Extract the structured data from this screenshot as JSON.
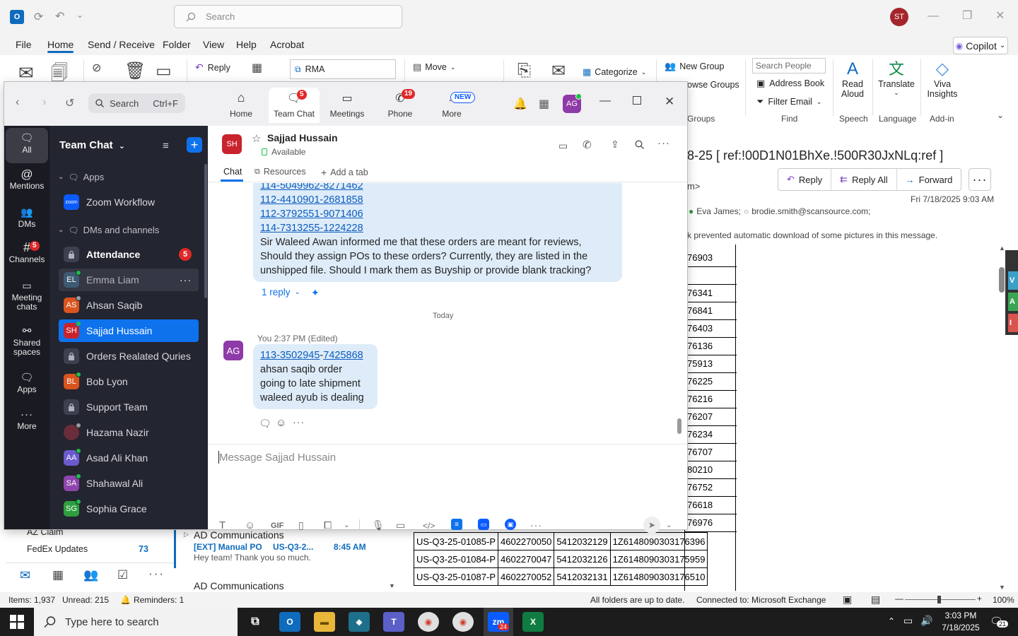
{
  "outlook": {
    "search_placeholder": "Search",
    "avatar": "ST",
    "menu": [
      "File",
      "Home",
      "Send / Receive",
      "Folder",
      "View",
      "Help",
      "Acrobat"
    ],
    "copilot": "Copilot",
    "ribbon": {
      "reply": "Reply",
      "quick_step": "RMA",
      "move": "Move",
      "categorize": "Categorize",
      "new_group": "New Group",
      "browse_groups": "owse Groups",
      "groups_label": "Groups",
      "search_people_placeholder": "Search People",
      "address_book": "Address Book",
      "filter_email": "Filter Email",
      "find_label": "Find",
      "read_aloud_1": "Read",
      "read_aloud_2": "Aloud",
      "speech_label": "Speech",
      "translate": "Translate",
      "language_label": "Language",
      "viva_1": "Viva",
      "viva_2": "Insights",
      "addin_label": "Add-in"
    },
    "email": {
      "subject": "8-25    [ ref:!00D1N01BhXe.!500R30JxNLq:ref ]",
      "reply": "Reply",
      "reply_all": "Reply All",
      "forward": "Forward",
      "from_tail": "m>",
      "date": "Fri 7/18/2025 9:03 AM",
      "recipient1": "Eva James;",
      "recipient2": "brodie.smith@scansource.com;",
      "notice": "k prevented automatic download of some pictures in this message.",
      "tracking_tails": [
        "76903",
        "",
        "76341",
        "76841",
        "76403",
        "76136",
        "75913",
        "76225",
        "76216",
        "76207",
        "76234",
        "76707",
        "80210",
        "76752",
        "76618",
        "76976"
      ],
      "rows": [
        [
          "US-Q3-25-01085-P",
          "4602270050",
          "5412032129",
          "1Z6148090303176396"
        ],
        [
          "US-Q3-25-01084-P",
          "4602270047",
          "5412032126",
          "1Z6148090303175959"
        ],
        [
          "US-Q3-25-01087-P",
          "4602270052",
          "5412032131",
          "1Z6148090303176510"
        ]
      ]
    },
    "folders": [
      {
        "name": "AZ Claim",
        "count": ""
      },
      {
        "name": "FedEx Updates",
        "count": "73"
      }
    ],
    "maillist": {
      "group1": "AD Communications",
      "sender": "[EXT] Manual PO",
      "subject": "US-Q3-2...",
      "time": "8:45 AM",
      "preview": "Hey team!  Thank you so much.",
      "group2": "AD Communications"
    },
    "status": {
      "items": "Items: 1,937",
      "unread": "Unread: 215",
      "reminders": "Reminders: 1",
      "sync": "All folders are up to date.",
      "connection": "Connected to: Microsoft Exchange",
      "zoom": "100%"
    }
  },
  "taskbar": {
    "search_placeholder": "Type here to search",
    "time": "3:03 PM",
    "date": "7/18/2025",
    "notifications": "21",
    "zoom_badge": "24"
  },
  "zoom": {
    "search": "Search",
    "search_shortcut": "Ctrl+F",
    "tabs": [
      {
        "label": "Home",
        "badge": ""
      },
      {
        "label": "Team Chat",
        "badge": "5"
      },
      {
        "label": "Meetings",
        "badge": ""
      },
      {
        "label": "Phone",
        "badge": "19"
      },
      {
        "label": "More",
        "badge": "NEW"
      }
    ],
    "user_avatar": "AG",
    "rail": [
      {
        "label": "All",
        "badge": ""
      },
      {
        "label": "Mentions",
        "badge": ""
      },
      {
        "label": "DMs",
        "badge": ""
      },
      {
        "label": "Channels",
        "badge": "5"
      },
      {
        "label": "Meeting chats",
        "badge": ""
      },
      {
        "label": "Shared spaces",
        "badge": ""
      },
      {
        "label": "Apps",
        "badge": ""
      },
      {
        "label": "More",
        "badge": ""
      }
    ],
    "sidebar": {
      "title": "Team Chat",
      "apps_section": "Apps",
      "zoom_workflow": "Zoom Workflow",
      "dms_section": "DMs and channels",
      "items": [
        {
          "initials": "",
          "name": "Attendance",
          "count": "5",
          "color": "",
          "locked": true
        },
        {
          "initials": "EL",
          "name": "Emma Liam",
          "count": "",
          "color": "#3f5a73",
          "locked": false
        },
        {
          "initials": "AS",
          "name": "Ahsan Saqib",
          "count": "",
          "color": "#d9541e",
          "locked": false
        },
        {
          "initials": "SH",
          "name": "Sajjad Hussain",
          "count": "",
          "color": "#c9232d",
          "locked": false
        },
        {
          "initials": "",
          "name": "Orders Realated Quries",
          "count": "",
          "color": "",
          "locked": true
        },
        {
          "initials": "BL",
          "name": "Bob Lyon",
          "count": "",
          "color": "#d9541e",
          "locked": false
        },
        {
          "initials": "",
          "name": "Support Team",
          "count": "",
          "color": "",
          "locked": true
        },
        {
          "initials": "",
          "name": "Hazama Nazir",
          "count": "",
          "color": "#6b2d3a",
          "locked": false
        },
        {
          "initials": "AA",
          "name": "Asad Ali Khan",
          "count": "",
          "color": "#6a5acd",
          "locked": false
        },
        {
          "initials": "SA",
          "name": "Shahawal Ali",
          "count": "",
          "color": "#8e44ad",
          "locked": false
        },
        {
          "initials": "SG",
          "name": "Sophia Grace",
          "count": "",
          "color": "#2e9e3f",
          "locked": false
        }
      ]
    },
    "chat": {
      "avatar": "SH",
      "name": "Sajjad Hussain",
      "status": "Available",
      "tabs": [
        "Chat",
        "Resources",
        "Add a tab"
      ],
      "msg1": {
        "links": [
          "114-5049962-8271462",
          "112-4410901-2681858",
          "112-3792551-9071406",
          "114-7313255-1224228"
        ],
        "text_lines": [
          "Sir Waleed Awan informed me that these orders are meant for reviews,",
          "Should they assign POs to these orders? Currently, they are listed in the",
          "unshipped file. Should I mark them as Buyship or provide blank tracking?"
        ],
        "reply_count": "1 reply"
      },
      "day_divider": "Today",
      "msg2": {
        "avatar": "AG",
        "meta": "You 2:37 PM (Edited)",
        "link_a": "113-3502945",
        "link_sep": "-",
        "link_b": "7425868",
        "lines": [
          "ahsan saqib order",
          "going to late shipment",
          "waleed ayub is dealing"
        ]
      },
      "compose_placeholder": "Message Sajjad Hussain",
      "gif": "GIF"
    }
  }
}
